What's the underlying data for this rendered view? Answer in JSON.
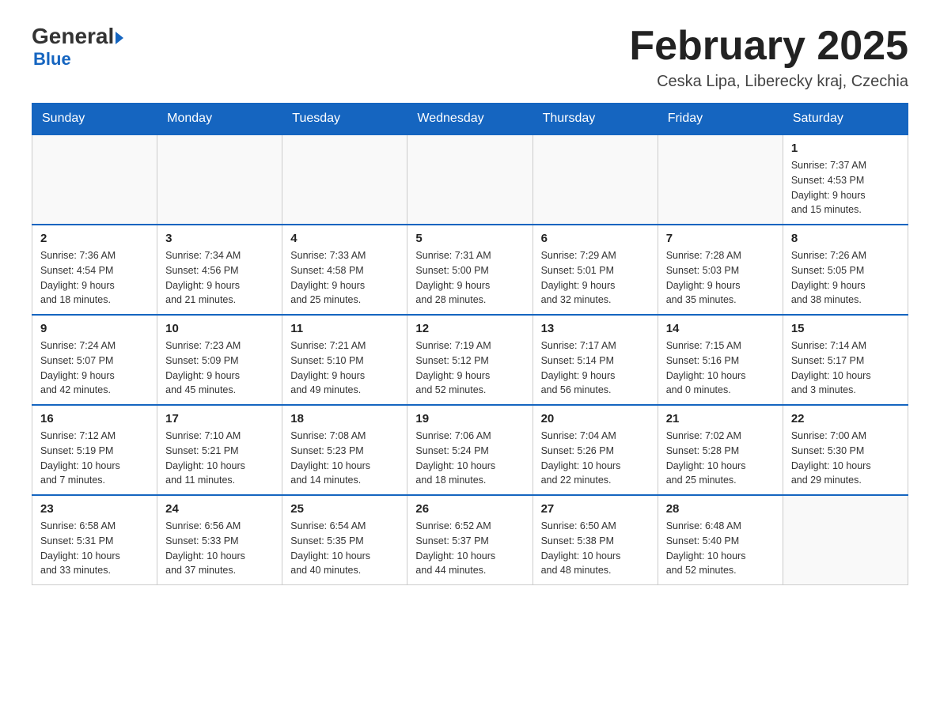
{
  "header": {
    "logo_general": "General",
    "logo_blue": "Blue",
    "month_title": "February 2025",
    "location": "Ceska Lipa, Liberecky kraj, Czechia"
  },
  "days_of_week": [
    "Sunday",
    "Monday",
    "Tuesday",
    "Wednesday",
    "Thursday",
    "Friday",
    "Saturday"
  ],
  "weeks": [
    {
      "days": [
        {
          "number": "",
          "info": ""
        },
        {
          "number": "",
          "info": ""
        },
        {
          "number": "",
          "info": ""
        },
        {
          "number": "",
          "info": ""
        },
        {
          "number": "",
          "info": ""
        },
        {
          "number": "",
          "info": ""
        },
        {
          "number": "1",
          "info": "Sunrise: 7:37 AM\nSunset: 4:53 PM\nDaylight: 9 hours\nand 15 minutes."
        }
      ]
    },
    {
      "days": [
        {
          "number": "2",
          "info": "Sunrise: 7:36 AM\nSunset: 4:54 PM\nDaylight: 9 hours\nand 18 minutes."
        },
        {
          "number": "3",
          "info": "Sunrise: 7:34 AM\nSunset: 4:56 PM\nDaylight: 9 hours\nand 21 minutes."
        },
        {
          "number": "4",
          "info": "Sunrise: 7:33 AM\nSunset: 4:58 PM\nDaylight: 9 hours\nand 25 minutes."
        },
        {
          "number": "5",
          "info": "Sunrise: 7:31 AM\nSunset: 5:00 PM\nDaylight: 9 hours\nand 28 minutes."
        },
        {
          "number": "6",
          "info": "Sunrise: 7:29 AM\nSunset: 5:01 PM\nDaylight: 9 hours\nand 32 minutes."
        },
        {
          "number": "7",
          "info": "Sunrise: 7:28 AM\nSunset: 5:03 PM\nDaylight: 9 hours\nand 35 minutes."
        },
        {
          "number": "8",
          "info": "Sunrise: 7:26 AM\nSunset: 5:05 PM\nDaylight: 9 hours\nand 38 minutes."
        }
      ]
    },
    {
      "days": [
        {
          "number": "9",
          "info": "Sunrise: 7:24 AM\nSunset: 5:07 PM\nDaylight: 9 hours\nand 42 minutes."
        },
        {
          "number": "10",
          "info": "Sunrise: 7:23 AM\nSunset: 5:09 PM\nDaylight: 9 hours\nand 45 minutes."
        },
        {
          "number": "11",
          "info": "Sunrise: 7:21 AM\nSunset: 5:10 PM\nDaylight: 9 hours\nand 49 minutes."
        },
        {
          "number": "12",
          "info": "Sunrise: 7:19 AM\nSunset: 5:12 PM\nDaylight: 9 hours\nand 52 minutes."
        },
        {
          "number": "13",
          "info": "Sunrise: 7:17 AM\nSunset: 5:14 PM\nDaylight: 9 hours\nand 56 minutes."
        },
        {
          "number": "14",
          "info": "Sunrise: 7:15 AM\nSunset: 5:16 PM\nDaylight: 10 hours\nand 0 minutes."
        },
        {
          "number": "15",
          "info": "Sunrise: 7:14 AM\nSunset: 5:17 PM\nDaylight: 10 hours\nand 3 minutes."
        }
      ]
    },
    {
      "days": [
        {
          "number": "16",
          "info": "Sunrise: 7:12 AM\nSunset: 5:19 PM\nDaylight: 10 hours\nand 7 minutes."
        },
        {
          "number": "17",
          "info": "Sunrise: 7:10 AM\nSunset: 5:21 PM\nDaylight: 10 hours\nand 11 minutes."
        },
        {
          "number": "18",
          "info": "Sunrise: 7:08 AM\nSunset: 5:23 PM\nDaylight: 10 hours\nand 14 minutes."
        },
        {
          "number": "19",
          "info": "Sunrise: 7:06 AM\nSunset: 5:24 PM\nDaylight: 10 hours\nand 18 minutes."
        },
        {
          "number": "20",
          "info": "Sunrise: 7:04 AM\nSunset: 5:26 PM\nDaylight: 10 hours\nand 22 minutes."
        },
        {
          "number": "21",
          "info": "Sunrise: 7:02 AM\nSunset: 5:28 PM\nDaylight: 10 hours\nand 25 minutes."
        },
        {
          "number": "22",
          "info": "Sunrise: 7:00 AM\nSunset: 5:30 PM\nDaylight: 10 hours\nand 29 minutes."
        }
      ]
    },
    {
      "days": [
        {
          "number": "23",
          "info": "Sunrise: 6:58 AM\nSunset: 5:31 PM\nDaylight: 10 hours\nand 33 minutes."
        },
        {
          "number": "24",
          "info": "Sunrise: 6:56 AM\nSunset: 5:33 PM\nDaylight: 10 hours\nand 37 minutes."
        },
        {
          "number": "25",
          "info": "Sunrise: 6:54 AM\nSunset: 5:35 PM\nDaylight: 10 hours\nand 40 minutes."
        },
        {
          "number": "26",
          "info": "Sunrise: 6:52 AM\nSunset: 5:37 PM\nDaylight: 10 hours\nand 44 minutes."
        },
        {
          "number": "27",
          "info": "Sunrise: 6:50 AM\nSunset: 5:38 PM\nDaylight: 10 hours\nand 48 minutes."
        },
        {
          "number": "28",
          "info": "Sunrise: 6:48 AM\nSunset: 5:40 PM\nDaylight: 10 hours\nand 52 minutes."
        },
        {
          "number": "",
          "info": ""
        }
      ]
    }
  ]
}
